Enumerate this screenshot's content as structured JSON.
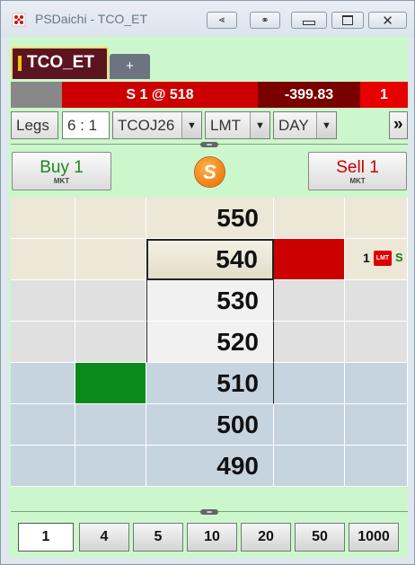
{
  "window": {
    "title": "PSDaichi - TCO_ET"
  },
  "tabs": {
    "active_label": "TCO_ET",
    "add_label": "+"
  },
  "status_bar": {
    "position_text": "S 1 @ 518",
    "pnl": "-399.83",
    "count": "1"
  },
  "controls": {
    "legs_label": "Legs",
    "ratio_value": "6 : 1",
    "contract": "TCOJ26",
    "order_type": "LMT",
    "duration": "DAY",
    "more_label": "»"
  },
  "actions": {
    "buy_label": "Buy 1",
    "buy_sub": "MKT",
    "sell_label": "Sell 1",
    "sell_sub": "MKT",
    "logo_letter": "S"
  },
  "ladder": {
    "prices": [
      "550",
      "540",
      "530",
      "520",
      "510",
      "500",
      "490"
    ],
    "working_order": {
      "qty": "1",
      "type_badge": "LMT",
      "extra": "S"
    },
    "colors": {
      "band_tan": "#ede7d8",
      "band_grey": "#e0e0e0",
      "band_blue": "#c6d4e0",
      "bid": "#0a8a1a",
      "ask": "#cc0000"
    }
  },
  "quantities": [
    "1",
    "4",
    "5",
    "10",
    "20",
    "50",
    "1000"
  ],
  "selected_quantity": "1"
}
